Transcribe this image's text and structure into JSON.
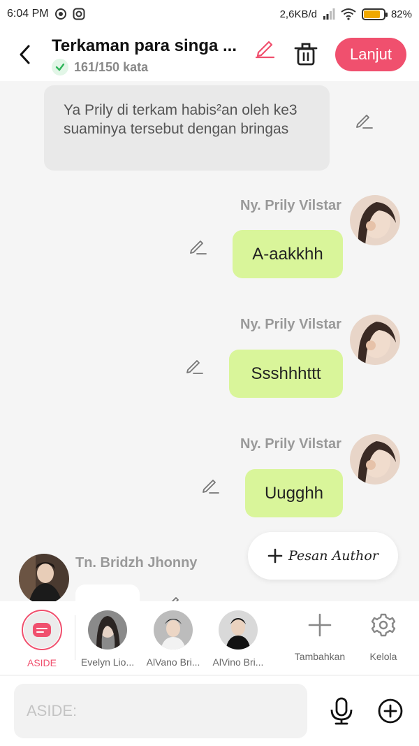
{
  "status_bar": {
    "time": "6:04 PM",
    "net_speed": "2,6KB/d",
    "battery": "82%",
    "battery_level": 0.82
  },
  "header": {
    "title": "Terkaman para singa ...",
    "word_count": "161/150 kata",
    "next_label": "Lanjut"
  },
  "messages": {
    "narration": "Ya Prily di terkam habis²an oleh ke3 suaminya tersebut dengan bringas",
    "m1": {
      "name": "Ny. Prily Vilstar",
      "text": "A-aakkhh"
    },
    "m2": {
      "name": "Ny. Prily Vilstar",
      "text": "Ssshhhttt"
    },
    "m3": {
      "name": "Ny. Prily Vilstar",
      "text": "Uugghh"
    },
    "m4": {
      "name": "Tn. Bridzh Jhonny"
    }
  },
  "pesan_author": "Pesan Author",
  "characters": [
    {
      "label": "ASIDE",
      "color": "#f0506e"
    },
    {
      "label": "Evelyn Lio..."
    },
    {
      "label": "AlVano Bri..."
    },
    {
      "label": "AlVino Bri..."
    }
  ],
  "actions": {
    "add_label": "Tambahkan",
    "manage_label": "Kelola"
  },
  "input": {
    "placeholder": "ASIDE:"
  },
  "colors": {
    "accent": "#f0506e",
    "bubble": "#d9f59a",
    "narration_bg": "#e9e9e9"
  },
  "icons": [
    "back-arrow-icon",
    "pencil-icon",
    "trash-icon",
    "check-icon",
    "plus-icon",
    "gear-icon",
    "microphone-icon",
    "plus-circle-icon"
  ]
}
